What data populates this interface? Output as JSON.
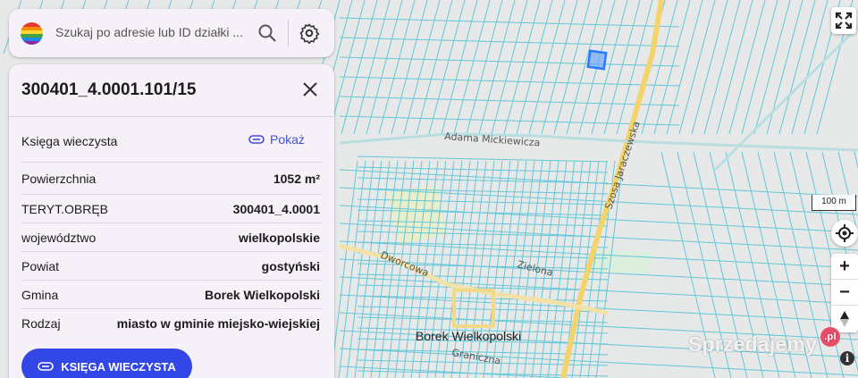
{
  "search": {
    "placeholder": "Szukaj po adresie lub ID działki ..."
  },
  "panel": {
    "title": "300401_4.0001.101/15",
    "rows": [
      {
        "label": "Księga wieczysta",
        "value": ""
      },
      {
        "label": "Powierzchnia",
        "value": "1052 m²"
      },
      {
        "label": "TERYT.OBRĘB",
        "value": "300401_4.0001"
      },
      {
        "label": "województwo",
        "value": "wielkopolskie"
      },
      {
        "label": "Powiat",
        "value": "gostyński"
      },
      {
        "label": "Gmina",
        "value": "Borek Wielkopolski"
      },
      {
        "label": "Rodzaj",
        "value": "miasto w gminie miejsko-wiejskiej"
      }
    ],
    "pokaz_label": "Pokaż",
    "book_button_label": "KSIĘGA WIECZYSTA"
  },
  "map": {
    "streets": [
      "Adama Mickiewicza",
      "Szosa Jaraczewska",
      "Dworcowa",
      "Zielona",
      "Graniczna"
    ],
    "town": "Borek Wielkopolski",
    "scale_label": "100 m",
    "watermark": "Sprzedajemy",
    "watermark_badge": ".pl"
  },
  "colors": {
    "accent": "#3346e6",
    "parcel_line": "#4fc3d8",
    "road": "#f3d36b",
    "selected_parcel": "#2979ff",
    "panel_bg": "#f6f1f8"
  }
}
